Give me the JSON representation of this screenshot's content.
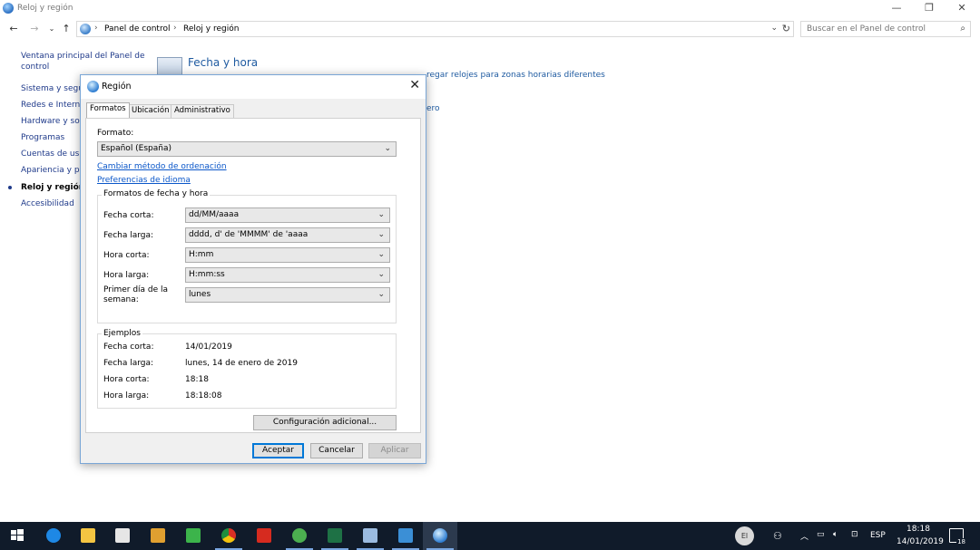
{
  "window": {
    "title": "Reloj y región",
    "minimize": "—",
    "maximize": "❐",
    "close": "✕"
  },
  "nav": {
    "back": "←",
    "forward": "→",
    "recent": "⌄",
    "up": "↑",
    "breadcrumbs": [
      "Panel de control",
      "Reloj y región"
    ],
    "dropdown": "⌄",
    "refresh": "↻",
    "search_placeholder": "Buscar en el Panel de control"
  },
  "sidebar": {
    "items": [
      {
        "label": "Ventana principal del Panel de",
        "label2": "control",
        "active": false
      },
      {
        "label": "Sistema y segur",
        "active": false
      },
      {
        "label": "Redes e Internet",
        "active": false
      },
      {
        "label": "Hardware y son",
        "active": false
      },
      {
        "label": "Programas",
        "active": false
      },
      {
        "label": "Cuentas de usu",
        "active": false
      },
      {
        "label": "Apariencia y pe",
        "active": false
      },
      {
        "label": "Reloj y región",
        "active": true
      },
      {
        "label": "Accesibilidad",
        "active": false
      }
    ]
  },
  "content": {
    "section_title": "Fecha y hora",
    "links": [
      "regar relojes para zonas horarias diferentes",
      "ero"
    ]
  },
  "dialog": {
    "title": "Región",
    "close": "✕",
    "tabs": [
      "Formatos",
      "Ubicación",
      "Administrativo"
    ],
    "active_tab": "Formatos",
    "formato_label": "Formato:",
    "formato_value": "Español (España)",
    "link_orden": "Cambiar método de ordenación",
    "link_idioma": "Preferencias de idioma",
    "formats_group_title": "Formatos de fecha y hora",
    "formats": [
      {
        "label": "Fecha corta:",
        "value": "dd/MM/aaaa"
      },
      {
        "label": "Fecha larga:",
        "value": "dddd, d' de 'MMMM' de 'aaaa"
      },
      {
        "label": "Hora corta:",
        "value": "H:mm"
      },
      {
        "label": "Hora larga:",
        "value": "H:mm:ss"
      },
      {
        "label": "Primer día de la",
        "label2": "semana:",
        "value": "lunes"
      }
    ],
    "examples_group_title": "Ejemplos",
    "examples": [
      {
        "label": "Fecha corta:",
        "value": "14/01/2019"
      },
      {
        "label": "Fecha larga:",
        "value": "lunes, 14 de enero de 2019"
      },
      {
        "label": "Hora corta:",
        "value": "18:18"
      },
      {
        "label": "Hora larga:",
        "value": "18:18:08"
      }
    ],
    "additional_button": "Configuración adicional...",
    "ok_button": "Aceptar",
    "cancel_button": "Cancelar",
    "apply_button": "Aplicar"
  },
  "taskbar": {
    "apps": [
      {
        "name": "start",
        "color": "#ffffff"
      },
      {
        "name": "edge",
        "color": "#1e88e5"
      },
      {
        "name": "file-explorer",
        "color": "#f4c542"
      },
      {
        "name": "store",
        "color": "#e6e6e6"
      },
      {
        "name": "media",
        "color": "#e0a030"
      },
      {
        "name": "stocks",
        "color": "#3cb44b"
      },
      {
        "name": "chrome",
        "color": "#d93025"
      },
      {
        "name": "acrobat",
        "color": "#d62b1f"
      },
      {
        "name": "utorrent",
        "color": "#4caf50"
      },
      {
        "name": "excel",
        "color": "#1e7145"
      },
      {
        "name": "taskmgr",
        "color": "#9bbbe0"
      },
      {
        "name": "remote",
        "color": "#3b8fd6"
      },
      {
        "name": "control-panel",
        "color": "#5aa0e6"
      }
    ],
    "avatar_text": "El",
    "language": "ESP",
    "time": "18:18",
    "date": "14/01/2019",
    "notification_count": "18"
  }
}
